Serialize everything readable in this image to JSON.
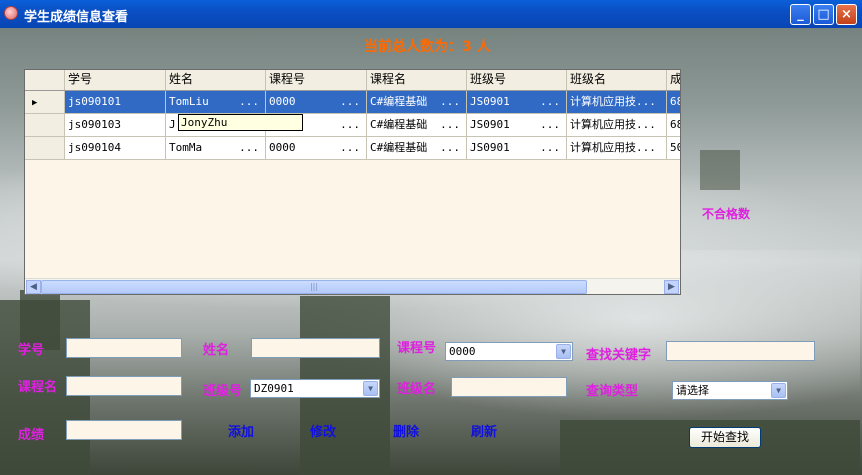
{
  "window": {
    "title": "学生成绩信息查看",
    "minimize": "_",
    "maximize": "□",
    "close": "×"
  },
  "count_label": "当前总人数为：3 人",
  "grid": {
    "columns": [
      "学号",
      "姓名",
      "课程号",
      "课程名",
      "班级号",
      "班级名",
      "成"
    ],
    "rows": [
      {
        "selected": true,
        "cells": [
          "js090101",
          "TomLiu",
          "0000",
          "C#编程基础",
          "JS0901",
          "计算机应用技...",
          "68"
        ]
      },
      {
        "selected": false,
        "cells": [
          "js090103",
          "J",
          "",
          "C#编程基础",
          "JS0901",
          "计算机应用技...",
          "68"
        ]
      },
      {
        "selected": false,
        "cells": [
          "js090104",
          "TomMa",
          "0000",
          "C#编程基础",
          "JS0901",
          "计算机应用技...",
          "50"
        ]
      }
    ],
    "ellipsis": "...",
    "row_marker": "▶",
    "tooltip": "JonyZhu",
    "scroll_left": "◀",
    "scroll_right": "▶",
    "thumb_grip": "|||"
  },
  "fail_label": "不合格数",
  "form": {
    "student_id_label": "学号",
    "name_label": "姓名",
    "course_id_label": "课程号",
    "course_id_value": "0000",
    "search_keyword_label": "查找关键字",
    "course_name_label": "课程名",
    "class_id_label": "班级号",
    "class_id_value": "DZ0901",
    "class_name_label": "班级名",
    "query_type_label": "查询类型",
    "query_type_value": "请选择",
    "score_label": "成绩",
    "dropdown_arrow": "▼"
  },
  "actions": {
    "add": "添加",
    "modify": "修改",
    "delete": "删除",
    "refresh": "刷新",
    "search": "开始查找"
  },
  "colors": {
    "title_bar": "#0a4fc4",
    "count_text": "#ff6a00",
    "magenta_label": "#e020e0",
    "blue_label": "#1010e0",
    "selection": "#316ac5"
  }
}
